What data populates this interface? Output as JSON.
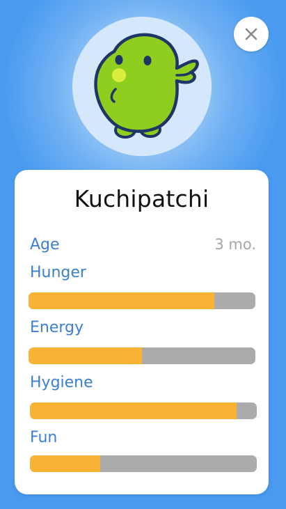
{
  "pet": {
    "name": "Kuchipatchi",
    "icon": "kuchipatchi-avatar",
    "body_color": "#8fce1f",
    "outline_color": "#1f3566"
  },
  "stats": {
    "age": {
      "label": "Age",
      "value": "3 mo."
    },
    "hunger": {
      "label": "Hunger",
      "level": 0.82
    },
    "energy": {
      "label": "Energy",
      "level": 0.5
    },
    "hygiene": {
      "label": "Hygiene",
      "level": 0.91
    },
    "fun": {
      "label": "Fun",
      "level": 0.31
    }
  },
  "controls": {
    "close_icon": "close-icon"
  },
  "colors": {
    "background": "#4a9bf0",
    "label": "#3b7fd0",
    "bar_fill": "#f9b233",
    "bar_track": "#ababab"
  }
}
